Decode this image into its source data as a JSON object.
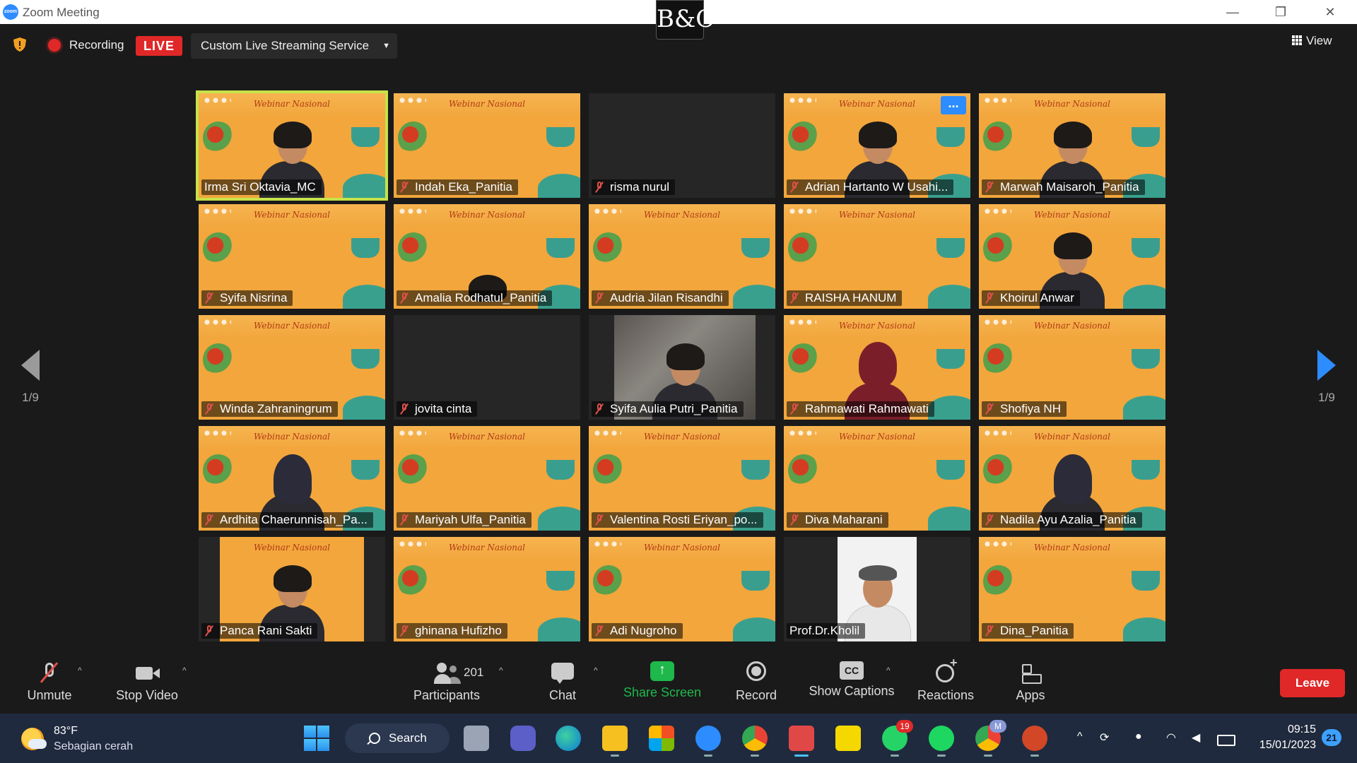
{
  "window": {
    "title": "Zoom Meeting",
    "brand_mark": "B&O"
  },
  "status": {
    "recording_label": "Recording",
    "live_label": "LIVE",
    "stream_service": "Custom Live Streaming Service",
    "view_label": "View"
  },
  "pager": {
    "left": "1/9",
    "right": "1/9"
  },
  "tiles": [
    {
      "name": "Irma Sri Oktavia_MC",
      "muted": false,
      "active": true
    },
    {
      "name": "Indah Eka_Panitia",
      "muted": true
    },
    {
      "name": "risma nurul",
      "muted": true
    },
    {
      "name": "Adrian Hartanto W Usahi...",
      "muted": true,
      "more": "..."
    },
    {
      "name": "Marwah Maisaroh_Panitia",
      "muted": true
    },
    {
      "name": "Syifa Nisrina",
      "muted": true
    },
    {
      "name": "Amalia Rodhatul_Panitia",
      "muted": true
    },
    {
      "name": "Audria Jilan Risandhi",
      "muted": true
    },
    {
      "name": "RAISHA HANUM",
      "muted": true
    },
    {
      "name": "Khoirul Anwar",
      "muted": true
    },
    {
      "name": "Winda Zahraningrum",
      "muted": true
    },
    {
      "name": "jovita cinta",
      "muted": true
    },
    {
      "name": "Syifa Aulia Putri_Panitia",
      "muted": true
    },
    {
      "name": "Rahmawati Rahmawati",
      "muted": true
    },
    {
      "name": "Shofiya NH",
      "muted": true
    },
    {
      "name": "Ardhita Chaerunnisah_Pa...",
      "muted": true
    },
    {
      "name": "Mariyah Ulfa_Panitia",
      "muted": true
    },
    {
      "name": "Valentina Rosti Eriyan_po...",
      "muted": true
    },
    {
      "name": "Diva Maharani",
      "muted": true
    },
    {
      "name": "Nadila Ayu Azalia_Panitia",
      "muted": true
    },
    {
      "name": "Panca Rani Sakti",
      "muted": true
    },
    {
      "name": "ghinana Hufizho",
      "muted": true
    },
    {
      "name": "Adi Nugroho",
      "muted": true
    },
    {
      "name": "Prof.Dr.Kholil",
      "muted": false
    },
    {
      "name": "Dina_Panitia",
      "muted": true
    }
  ],
  "webinar_text": "Webinar Nasional",
  "toolbar": {
    "unmute": "Unmute",
    "stop_video": "Stop Video",
    "participants": "Participants",
    "participants_count": "201",
    "chat": "Chat",
    "share_screen": "Share Screen",
    "record": "Record",
    "show_captions": "Show Captions",
    "captions_icon": "CC",
    "reactions": "Reactions",
    "apps": "Apps",
    "leave": "Leave"
  },
  "taskbar": {
    "temp": "83°F",
    "condition": "Sebagian cerah",
    "search": "Search",
    "whatsapp_badge": "19",
    "chrome_badge": "M",
    "time": "09:15",
    "date": "15/01/2023",
    "notifications": "21"
  },
  "colors": {
    "live": "#e02828",
    "share": "#1fb84c",
    "accent": "#2d8cff",
    "active_tile": "#c6e24a",
    "webinar_bg": "#f2a63c"
  }
}
